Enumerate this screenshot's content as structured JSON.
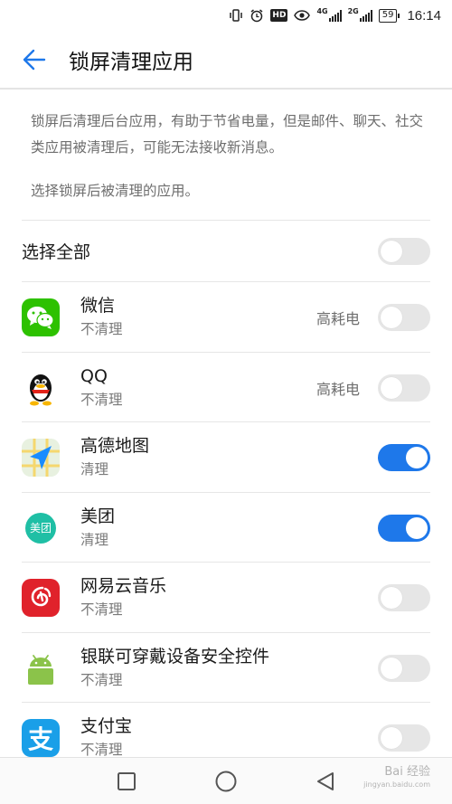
{
  "status_bar": {
    "network_1": "4G",
    "network_2": "2G",
    "hd_label": "HD",
    "battery": "59",
    "time": "16:14"
  },
  "header": {
    "title": "锁屏清理应用"
  },
  "description": {
    "text": "锁屏后清理后台应用，有助于节省电量，但是邮件、聊天、社交类应用被清理后，可能无法接收新消息。",
    "hint": "选择锁屏后被清理的应用。"
  },
  "select_all": {
    "label": "选择全部",
    "enabled": false
  },
  "apps": [
    {
      "name": "微信",
      "status": "不清理",
      "tag": "高耗电",
      "enabled": false,
      "icon": "wechat-icon"
    },
    {
      "name": "QQ",
      "status": "不清理",
      "tag": "高耗电",
      "enabled": false,
      "icon": "qq-icon"
    },
    {
      "name": "高德地图",
      "status": "清理",
      "tag": "",
      "enabled": true,
      "icon": "amap-icon"
    },
    {
      "name": "美团",
      "status": "清理",
      "tag": "",
      "enabled": true,
      "icon": "meituan-icon",
      "icon_text": "美团"
    },
    {
      "name": "网易云音乐",
      "status": "不清理",
      "tag": "",
      "enabled": false,
      "icon": "netease-music-icon"
    },
    {
      "name": "银联可穿戴设备安全控件",
      "status": "不清理",
      "tag": "",
      "enabled": false,
      "icon": "android-icon"
    },
    {
      "name": "支付宝",
      "status": "不清理",
      "tag": "",
      "enabled": false,
      "icon": "alipay-icon",
      "icon_text": "支"
    }
  ],
  "watermark": {
    "text": "Bai 经验",
    "sub": "jingyan.baidu.com"
  },
  "colors": {
    "accent": "#1e78ea",
    "toggle_off": "#e6e6e6",
    "wechat": "#2dc100",
    "meituan": "#1fbfa5",
    "netease": "#e0222b",
    "alipay": "#1a9fe8",
    "android": "#8bc34a"
  }
}
